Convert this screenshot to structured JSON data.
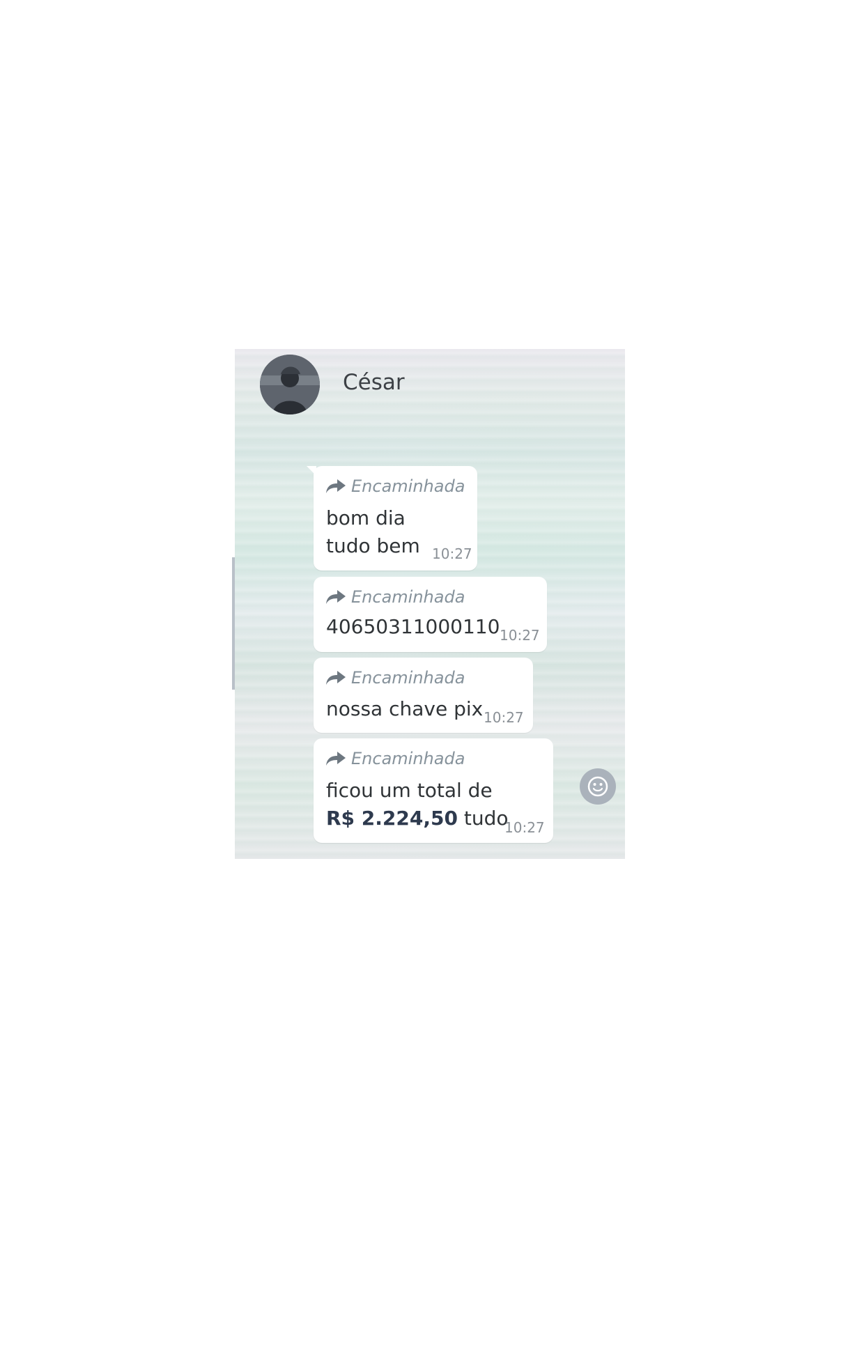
{
  "contact": {
    "name": "César"
  },
  "messages": [
    {
      "forwarded_label": "Encaminhada",
      "lines": [
        "bom dia",
        "tudo bem"
      ],
      "time": "10:27"
    },
    {
      "forwarded_label": "Encaminhada",
      "lines": [
        "40650311000110"
      ],
      "time": "10:27"
    },
    {
      "forwarded_label": "Encaminhada",
      "lines": [
        "nossa chave pix"
      ],
      "time": "10:27"
    },
    {
      "forwarded_label": "Encaminhada",
      "line1": "ficou um total de",
      "amount": "R$ 2.224,50",
      "line2_suffix": " tudo",
      "time": "10:27"
    }
  ],
  "icons": {
    "forward": "forward-arrow-icon",
    "emoji": "smiley-icon",
    "avatar": "contact-avatar"
  }
}
